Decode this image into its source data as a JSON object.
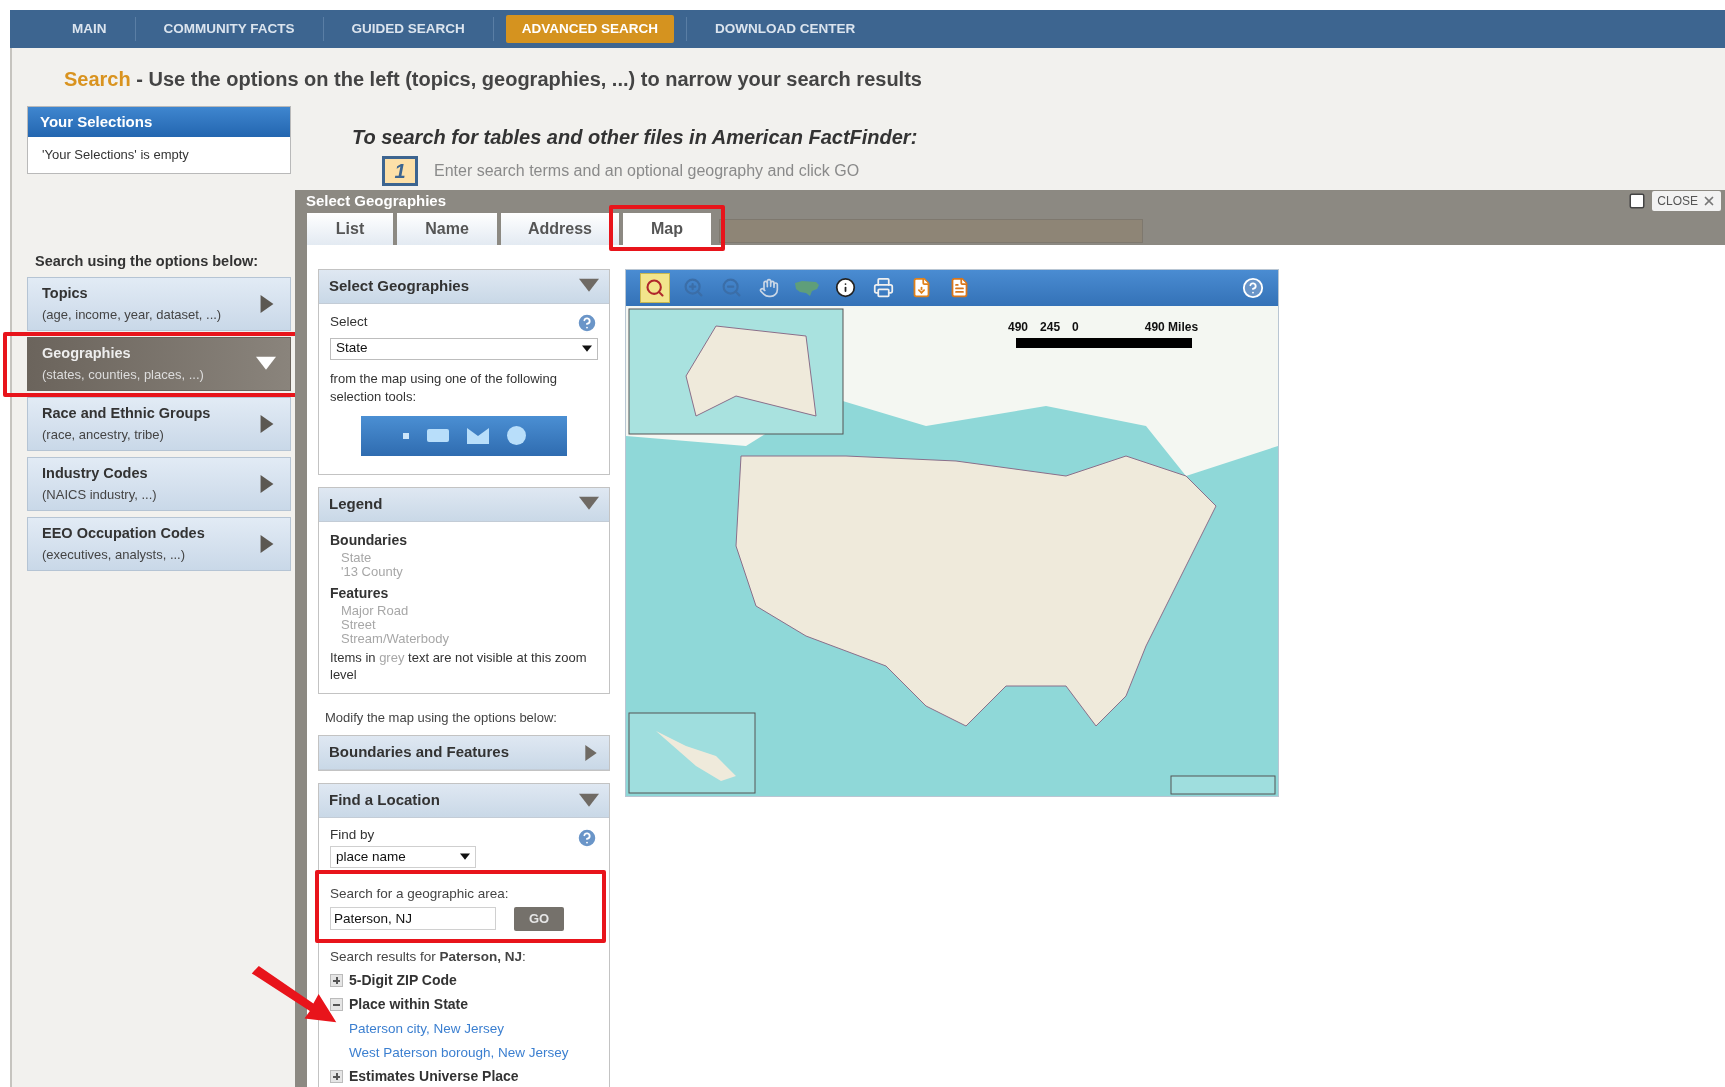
{
  "nav": [
    {
      "label": "MAIN",
      "selected": false
    },
    {
      "label": "COMMUNITY FACTS",
      "selected": false
    },
    {
      "label": "GUIDED SEARCH",
      "selected": false
    },
    {
      "label": "ADVANCED SEARCH",
      "selected": true
    },
    {
      "label": "DOWNLOAD CENTER",
      "selected": false
    }
  ],
  "heading": {
    "lead": "Search",
    "rest": "- Use the options on the left (topics, geographies, ...) to narrow your search results"
  },
  "selections": {
    "title": "Your Selections",
    "empty_text": "'Your Selections' is empty"
  },
  "intro": "To search for tables and other files in American FactFinder:",
  "step": {
    "number": "1",
    "text": "Enter search terms and an optional geography and click GO"
  },
  "options_label": "Search using the options below:",
  "options": [
    {
      "title": "Topics",
      "subtitle": "(age, income, year, dataset, ...)",
      "expanded": false,
      "highlighted": false
    },
    {
      "title": "Geographies",
      "subtitle": "(states, counties, places, ...)",
      "expanded": true,
      "highlighted": true
    },
    {
      "title": "Race and Ethnic Groups",
      "subtitle": "(race, ancestry, tribe)",
      "expanded": false,
      "highlighted": false
    },
    {
      "title": "Industry Codes",
      "subtitle": "(NAICS industry, ...)",
      "expanded": false,
      "highlighted": false
    },
    {
      "title": "EEO Occupation Codes",
      "subtitle": "(executives, analysts, ...)",
      "expanded": false,
      "highlighted": false
    }
  ],
  "dialog": {
    "title": "Select Geographies",
    "close": "CLOSE",
    "tabs": [
      {
        "label": "List",
        "selected": false,
        "highlighted": false
      },
      {
        "label": "Name",
        "selected": false,
        "highlighted": false
      },
      {
        "label": "Address",
        "selected": false,
        "highlighted": false
      },
      {
        "label": "Map",
        "selected": true,
        "highlighted": true
      }
    ]
  },
  "select_panel": {
    "title": "Select Geographies",
    "expanded": true,
    "select_label": "Select",
    "select_value": "State",
    "tools_text": "from the map using one of the following selection tools:"
  },
  "legend": {
    "title": "Legend",
    "expanded": true,
    "groups": [
      {
        "heading": "Boundaries",
        "items": [
          "State",
          "'13 County"
        ]
      },
      {
        "heading": "Features",
        "items": [
          "Major Road",
          "Street",
          "Stream/Waterbody"
        ]
      }
    ],
    "note": {
      "before": "Items in",
      "grey": "grey",
      "after": "text are not visible at this zoom level"
    }
  },
  "modify_text": "Modify the map using the options below:",
  "boundaries_panel": {
    "title": "Boundaries and Features",
    "expanded": false
  },
  "find_panel": {
    "title": "Find a Location",
    "expanded": true,
    "find_by_label": "Find by",
    "find_by_value": "place name",
    "search_label": "Search for a geographic area:",
    "search_value": "Paterson, NJ",
    "go": "GO",
    "highlighted": true,
    "results_label": "Search results for **Paterson, NJ**:",
    "results": [
      {
        "label": "5-Digit ZIP Code",
        "expanded": false
      },
      {
        "label": "Place within State",
        "expanded": true,
        "children": [
          {
            "label": "Paterson city, New Jersey"
          },
          {
            "label": "West Paterson borough, New Jersey"
          }
        ]
      },
      {
        "label": "Estimates Universe Place",
        "expanded": false
      }
    ]
  },
  "map": {
    "tools": [
      {
        "kind": "identify",
        "selected": true
      },
      {
        "kind": "zoom-in",
        "selected": false
      },
      {
        "kind": "zoom-out",
        "selected": false
      },
      {
        "kind": "pan",
        "selected": false
      },
      {
        "kind": "full-extent",
        "selected": false
      },
      {
        "kind": "info",
        "selected": false
      },
      {
        "kind": "print",
        "selected": false
      },
      {
        "kind": "download",
        "selected": false
      },
      {
        "kind": "bookmark",
        "selected": false
      }
    ],
    "scale": [
      "490",
      "245",
      "0",
      "490 Miles"
    ]
  }
}
